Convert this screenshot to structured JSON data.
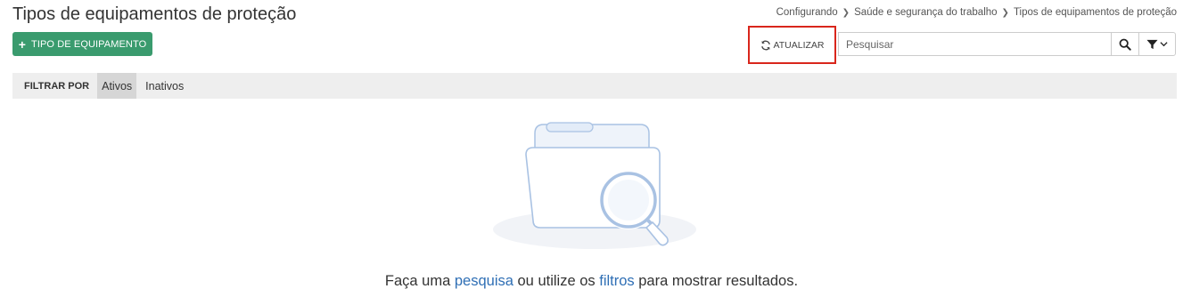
{
  "page": {
    "title": "Tipos de equipamentos de proteção"
  },
  "breadcrumb": {
    "items": [
      "Configurando",
      "Saúde e segurança do trabalho",
      "Tipos de equipamentos de proteção"
    ]
  },
  "toolbar": {
    "add_label": "TIPO DE EQUIPAMENTO",
    "refresh_label": "ATUALIZAR",
    "search_placeholder": "Pesquisar"
  },
  "filter_bar": {
    "label": "FILTRAR POR",
    "tabs": [
      {
        "label": "Ativos",
        "active": true
      },
      {
        "label": "Inativos",
        "active": false
      }
    ]
  },
  "empty_state": {
    "text_before": "Faça uma ",
    "link_search": "pesquisa",
    "text_middle": " ou utilize os ",
    "link_filters": "filtros",
    "text_after": " para mostrar resultados."
  },
  "colors": {
    "primary_green": "#3a9b6e",
    "highlight_red": "#d9261c",
    "link_blue": "#2f6fb5"
  },
  "icons": {
    "add": "plus-icon",
    "refresh": "refresh-icon",
    "search": "search-icon",
    "filter": "filter-icon",
    "dropdown": "chevron-down-icon",
    "breadcrumb_separator": "chevron-right-icon",
    "empty_state": "folder-search-illustration"
  }
}
